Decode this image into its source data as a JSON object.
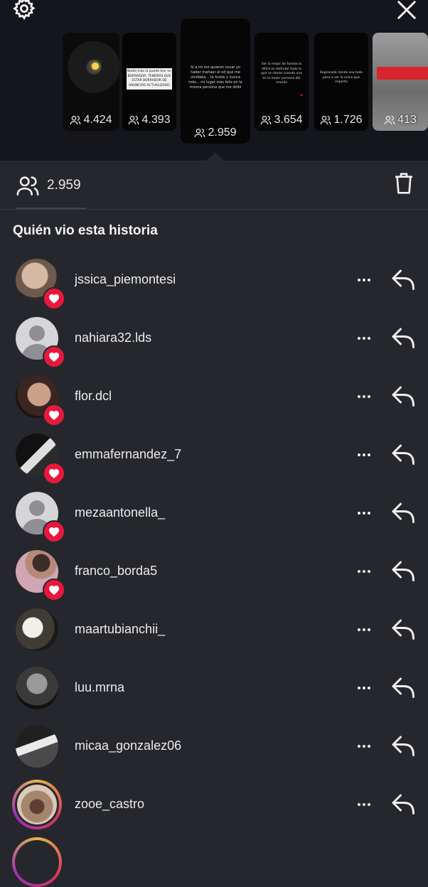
{
  "story_thumbnails": [
    {
      "count": "4.424",
      "text": ""
    },
    {
      "count": "4.393",
      "text": "Nadie más lo puede leer en BORRADOR. TENDRÁS QUE ESTAR BORRADOR DE ANUNCIOS ACTUALIZADO"
    },
    {
      "count": "2.959",
      "text": "Si a mi me quieren oscar yo haber mañaar el xd que me olvidaba... te fuiste y nunca más... mi lugar más feliz en la misma persona que me dolió"
    },
    {
      "count": "3.654",
      "text": "Ser la mejor de familia lo difícil es disfrutar todo lo que se siente cuando uno es la mejor persona del mundo"
    },
    {
      "count": "1.726",
      "text": "Regresado donde sea todo pasa a ser lo único que importa"
    },
    {
      "count": "413",
      "text": ""
    }
  ],
  "stats": {
    "viewers_count": "2.959"
  },
  "section_title": "Quién vio esta historia",
  "viewers": [
    {
      "username": "jssica_piemontesi",
      "liked": true
    },
    {
      "username": "nahiara32.lds",
      "liked": true
    },
    {
      "username": "flor.dcl",
      "liked": true
    },
    {
      "username": "emmafernandez_7",
      "liked": true
    },
    {
      "username": "mezaantonella_",
      "liked": true
    },
    {
      "username": "franco_borda5",
      "liked": true
    },
    {
      "username": "maartubianchii_",
      "liked": false
    },
    {
      "username": "luu.mrna",
      "liked": false
    },
    {
      "username": "micaa_gonzalez06",
      "liked": false
    },
    {
      "username": "zooe_castro",
      "liked": false
    }
  ],
  "icons": {
    "settings": "gear-icon",
    "close": "close-icon",
    "viewers": "people-icon",
    "delete": "trash-icon",
    "more": "more-icon",
    "reply": "reply-arrow-icon",
    "like": "heart-icon"
  },
  "colors": {
    "background": "#26272c",
    "topbar": "#14161b",
    "heart": "#e8183d"
  }
}
